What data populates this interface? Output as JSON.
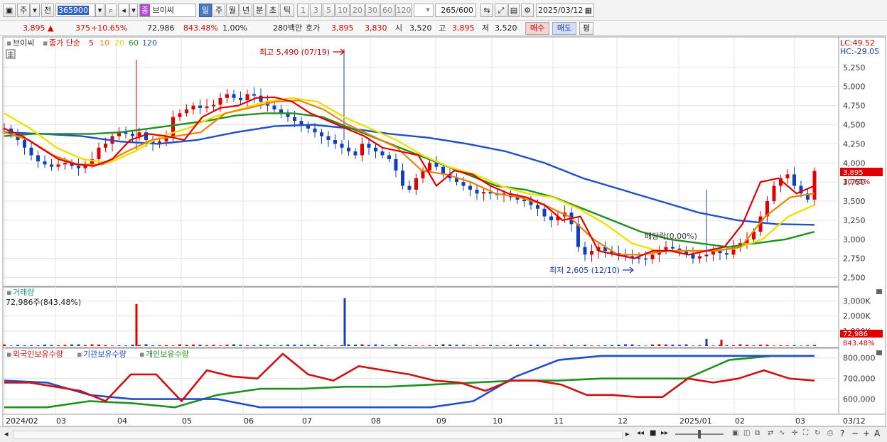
{
  "toolbar": {
    "period_type": "주",
    "market_label": "전",
    "code": "365900",
    "stock_badge": "종",
    "stock_name": "브이씨",
    "intervals": [
      "일",
      "주",
      "월",
      "년",
      "분",
      "초",
      "틱"
    ],
    "active_interval": "일",
    "minute_steps": [
      "1",
      "3",
      "5",
      "10",
      "20",
      "30",
      "60",
      "120"
    ],
    "count": "265",
    "count_total": "/600",
    "date": "2025/03/12"
  },
  "quote": {
    "price": "3,895",
    "change_arrow": "▲",
    "change": "375",
    "change_pct": "+10.65%",
    "volume": "72,986",
    "volume_ratio": "843.48%",
    "turnover_pct": "1.00%",
    "amount": "280백만",
    "ask_label": "호가",
    "ask": "3,895",
    "bid": "3,830",
    "open_label": "시",
    "open": "3,520",
    "high_label": "고",
    "high": "3,895",
    "low_label": "저",
    "low": "3,520",
    "buy_button": "매수",
    "sell_button": "매도",
    "avg_button": "평"
  },
  "price_panel": {
    "stock_label": "브이씨",
    "ma_label": "종가 단순",
    "ma_periods": [
      {
        "label": "5",
        "color": "#e00000"
      },
      {
        "label": "10",
        "color": "#f08000"
      },
      {
        "label": "20",
        "color": "#e8d800"
      },
      {
        "label": "60",
        "color": "#209020"
      },
      {
        "label": "120",
        "color": "#2050c8"
      }
    ],
    "lc": "LC:49.52",
    "hc": "HC:-29.05",
    "high_annotation": "최고 5,490 (07/19)",
    "low_annotation": "최저 2,605 (12/10)",
    "dividend_annotation": "배당락(0.00%)",
    "current_price_tag": "3,895",
    "current_pct_tag": "10.65%",
    "y_ticks": [
      "5,250",
      "5,000",
      "4,750",
      "4,500",
      "4,250",
      "4,000",
      "3,750",
      "3,500",
      "3,250",
      "3,000",
      "2,750",
      "2,500"
    ]
  },
  "volume_panel": {
    "title": "거래량",
    "value": "72,986주(843.48%)",
    "y_ticks": [
      "3,000K",
      "2,000K",
      "1,000K"
    ],
    "tag_volume": "72,986",
    "tag_pct": "843.48%"
  },
  "holdings_panel": {
    "series": [
      {
        "label": "외국인보유수량",
        "color": "#d01010"
      },
      {
        "label": "기관보유수량",
        "color": "#2050c8"
      },
      {
        "label": "개인보유수량",
        "color": "#209020"
      }
    ],
    "y_ticks": [
      "800,000",
      "700,000",
      "600,000"
    ]
  },
  "x_axis": [
    "2024/02",
    "03",
    "04",
    "05",
    "06",
    "07",
    "08",
    "09",
    "10",
    "11",
    "12",
    "2025/01",
    "02",
    "03",
    "03/12"
  ],
  "colors": {
    "up": "#e00000",
    "down": "#1040c0",
    "ma5": "#e00000",
    "ma10": "#f08000",
    "ma20": "#f0e000",
    "ma60": "#209020",
    "ma120": "#2050c8"
  },
  "chart_data": {
    "type": "candlestick",
    "title": "브이씨",
    "y_range": [
      2450,
      5490
    ],
    "summary": {
      "last_close": 3895,
      "period_high": 5490,
      "period_high_date": "07/19",
      "period_low": 2605,
      "period_low_date": "12/10"
    },
    "close_approx": [
      4450,
      4380,
      4300,
      4200,
      4100,
      4020,
      3980,
      3950,
      3980,
      4000,
      3960,
      3930,
      3980,
      4050,
      4200,
      4250,
      4350,
      4400,
      4380,
      4350,
      4400,
      4300,
      4250,
      4280,
      4350,
      4600,
      4650,
      4700,
      4750,
      4720,
      4740,
      4760,
      4850,
      4900,
      4850,
      4820,
      4900,
      4880,
      4800,
      4750,
      4700,
      4650,
      4600,
      4550,
      4500,
      4450,
      4400,
      4350,
      4300,
      4250,
      4200,
      4150,
      4100,
      4250,
      4200,
      4150,
      4100,
      4050,
      3900,
      3700,
      3650,
      3800,
      3900,
      4000,
      3950,
      3850,
      3800,
      3750,
      3700,
      3650,
      3600,
      3620,
      3600,
      3580,
      3600,
      3550,
      3520,
      3500,
      3450,
      3400,
      3300,
      3250,
      3300,
      3350,
      3200,
      2900,
      2800,
      2850,
      2900,
      2850,
      2820,
      2800,
      2780,
      2760,
      2750,
      2740,
      2800,
      2850,
      2900,
      2880,
      2850,
      2800,
      2750,
      2780,
      2800,
      2850,
      2820,
      2800,
      2900,
      2950,
      3000,
      3100,
      3300,
      3500,
      3700,
      3800,
      3850,
      3700,
      3600,
      3520,
      3895
    ],
    "ma5_approx": [
      4450,
      4350,
      4200,
      4050,
      3980,
      3960,
      4050,
      4300,
      4380,
      4350,
      4300,
      4600,
      4720,
      4750,
      4850,
      4860,
      4800,
      4650,
      4550,
      4450,
      4350,
      4200,
      4150,
      4100,
      3700,
      3900,
      3850,
      3700,
      3600,
      3550,
      3450,
      3250,
      3300,
      2850,
      2800,
      2750,
      2850,
      2850,
      2800,
      2850,
      2900,
      3200,
      3750,
      3800,
      3600,
      3700
    ],
    "ma10_approx": [
      4400,
      4300,
      4100,
      3980,
      3980,
      4150,
      4300,
      4350,
      4400,
      4650,
      4720,
      4800,
      4820,
      4700,
      4500,
      4350,
      4200,
      3900,
      3850,
      3750,
      3600,
      3550,
      3450,
      3300,
      3000,
      2800,
      2800,
      2850,
      2850,
      2850,
      2900,
      3300,
      3550,
      3600
    ],
    "ma20_approx": [
      4650,
      4450,
      4200,
      4050,
      4000,
      4150,
      4350,
      4450,
      4600,
      4700,
      4800,
      4850,
      4800,
      4600,
      4450,
      4300,
      4100,
      3950,
      3850,
      3700,
      3600,
      3550,
      3400,
      3200,
      2950,
      2850,
      2850,
      2850,
      2880,
      3000,
      3300,
      3450
    ],
    "ma60_approx": [
      4350,
      4380,
      4380,
      4380,
      4400,
      4450,
      4500,
      4550,
      4620,
      4650,
      4650,
      4600,
      4450,
      4300,
      4150,
      4000,
      3850,
      3700,
      3650,
      3550,
      3400,
      3250,
      3100,
      3000,
      2950,
      2900,
      2950,
      3000,
      3100
    ],
    "ma120_approx": [
      4400,
      4380,
      4350,
      4280,
      4250,
      4300,
      4400,
      4480,
      4500,
      4450,
      4380,
      4330,
      4250,
      4150,
      4000,
      3800,
      3650,
      3500,
      3350,
      3250,
      3200,
      3190
    ],
    "volume_spikes": [
      {
        "x": "04 (early)",
        "value": 2800000
      },
      {
        "x": "07/19",
        "value": 3200000
      },
      {
        "x": "2025/01",
        "value": 480000
      },
      {
        "x": "2025/01",
        "value": 420000
      }
    ],
    "holdings_series": [
      {
        "name": "외국인보유수량",
        "values_approx": [
          680000,
          680000,
          660000,
          640000,
          590000,
          720000,
          720000,
          590000,
          740000,
          710000,
          700000,
          820000,
          720000,
          690000,
          760000,
          740000,
          720000,
          690000,
          680000,
          640000,
          690000,
          690000,
          670000,
          620000,
          620000,
          610000,
          610000,
          700000,
          680000,
          700000,
          740000,
          700000,
          690000
        ]
      },
      {
        "name": "기관보유수량",
        "values_approx": [
          690000,
          680000,
          620000,
          600000,
          600000,
          600000,
          560000,
          560000,
          560000,
          560000,
          560000,
          590000,
          710000,
          790000,
          810000,
          810000,
          810000,
          810000,
          810000,
          810000
        ]
      },
      {
        "name": "개인보유수량",
        "values_approx": [
          560000,
          560000,
          590000,
          580000,
          560000,
          620000,
          650000,
          650000,
          660000,
          660000,
          670000,
          680000,
          690000,
          690000,
          700000,
          700000,
          700000,
          790000,
          810000,
          810000
        ]
      }
    ]
  }
}
